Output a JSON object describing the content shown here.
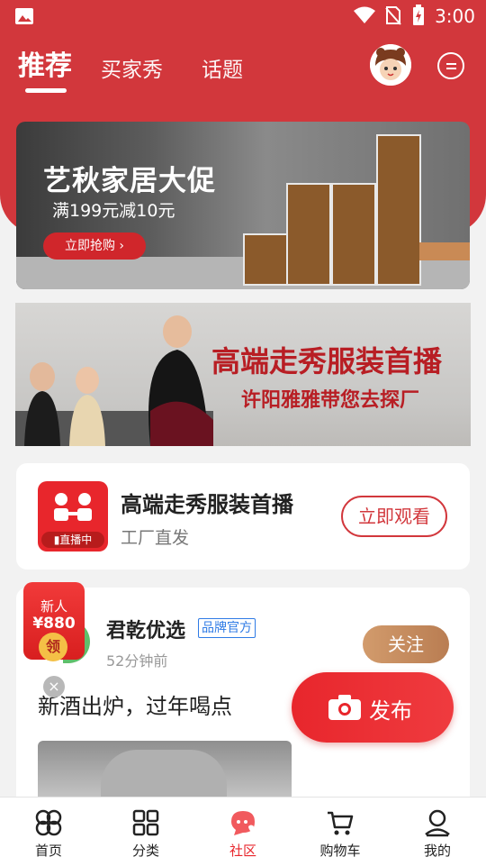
{
  "colors": {
    "brand_red": "#d2373c",
    "accent_red": "#e8262c",
    "follow_brown": "#c48a5f",
    "brand_blue": "#2f7be5"
  },
  "status_bar": {
    "time": "3:00",
    "icons": [
      "image-icon",
      "wifi-icon",
      "no-sim-icon",
      "battery-charging-icon"
    ]
  },
  "header": {
    "tabs": [
      {
        "label": "推荐",
        "active": true
      },
      {
        "label": "买家秀",
        "active": false
      },
      {
        "label": "话题",
        "active": false
      }
    ]
  },
  "banner1": {
    "title": "艺秋家居大促",
    "subtitle": "满199元减10元",
    "button": "立即抢购 ›"
  },
  "banner2": {
    "title": "高端走秀服装首播",
    "subtitle": "许阳雅雅带您去探厂"
  },
  "live_card": {
    "title": "高端走秀服装首播",
    "subtitle": "工厂直发",
    "badge": "直播中",
    "button": "立即观看"
  },
  "post": {
    "shop_name": "君乾优选",
    "tag": "品牌官方",
    "time": "52分钟前",
    "follow": "关注",
    "text": "新酒出炉，过年喝点"
  },
  "coupon": {
    "line1": "新人",
    "line2": "¥880",
    "line3": "领"
  },
  "fab": {
    "label": "发布"
  },
  "bottom_nav": [
    {
      "label": "首页",
      "icon": "home-icon",
      "active": false
    },
    {
      "label": "分类",
      "icon": "category-icon",
      "active": false
    },
    {
      "label": "社区",
      "icon": "community-icon",
      "active": true
    },
    {
      "label": "购物车",
      "icon": "cart-icon",
      "active": false
    },
    {
      "label": "我的",
      "icon": "profile-icon",
      "active": false
    }
  ]
}
